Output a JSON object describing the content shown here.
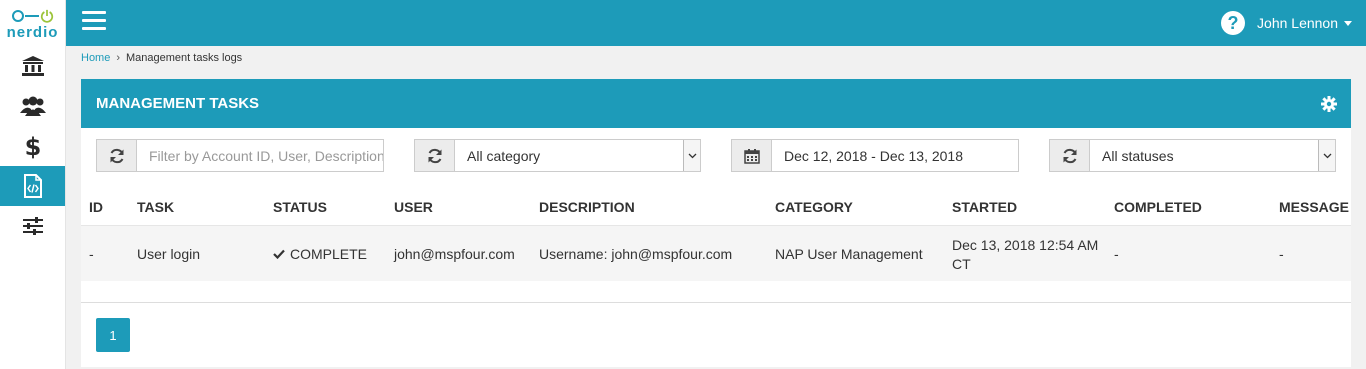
{
  "app": {
    "logo_text": "nerdio",
    "icons": {
      "power": "power-icon",
      "hamburger": "hamburger-icon",
      "help": "help-icon",
      "refresh": "refresh-icon",
      "calendar": "calendar-icon",
      "gear": "gear-icon",
      "check": "check-icon"
    },
    "accent_color": "#1d9bb9"
  },
  "sidebar": {
    "items": [
      {
        "icon": "bank-icon",
        "active": false
      },
      {
        "icon": "users-icon",
        "active": false
      },
      {
        "icon": "dollar-icon",
        "active": false
      },
      {
        "icon": "code-file-icon",
        "active": true
      },
      {
        "icon": "sliders-icon",
        "active": false
      }
    ]
  },
  "topbar": {
    "help_glyph": "?",
    "user_name": "John Lennon"
  },
  "breadcrumb": {
    "home": "Home",
    "separator": "›",
    "current": "Management tasks logs"
  },
  "panel": {
    "title": "MANAGEMENT TASKS"
  },
  "filters": {
    "search_placeholder": "Filter by Account ID, User, Description",
    "category_value": "All category",
    "date_range_value": "Dec 12, 2018 - Dec 13, 2018",
    "status_value": "All statuses"
  },
  "table": {
    "columns": [
      "ID",
      "TASK",
      "STATUS",
      "USER",
      "DESCRIPTION",
      "CATEGORY",
      "STARTED",
      "COMPLETED",
      "MESSAGE"
    ],
    "rows": [
      {
        "id": "-",
        "task": "User login",
        "status": "COMPLETE",
        "user": "john@mspfour.com",
        "description": "Username: john@mspfour.com",
        "category": "NAP User Management",
        "started": "Dec 13, 2018 12:54 AM CT",
        "completed": "-",
        "message": "-"
      }
    ]
  },
  "pagination": {
    "current_page": "1"
  }
}
